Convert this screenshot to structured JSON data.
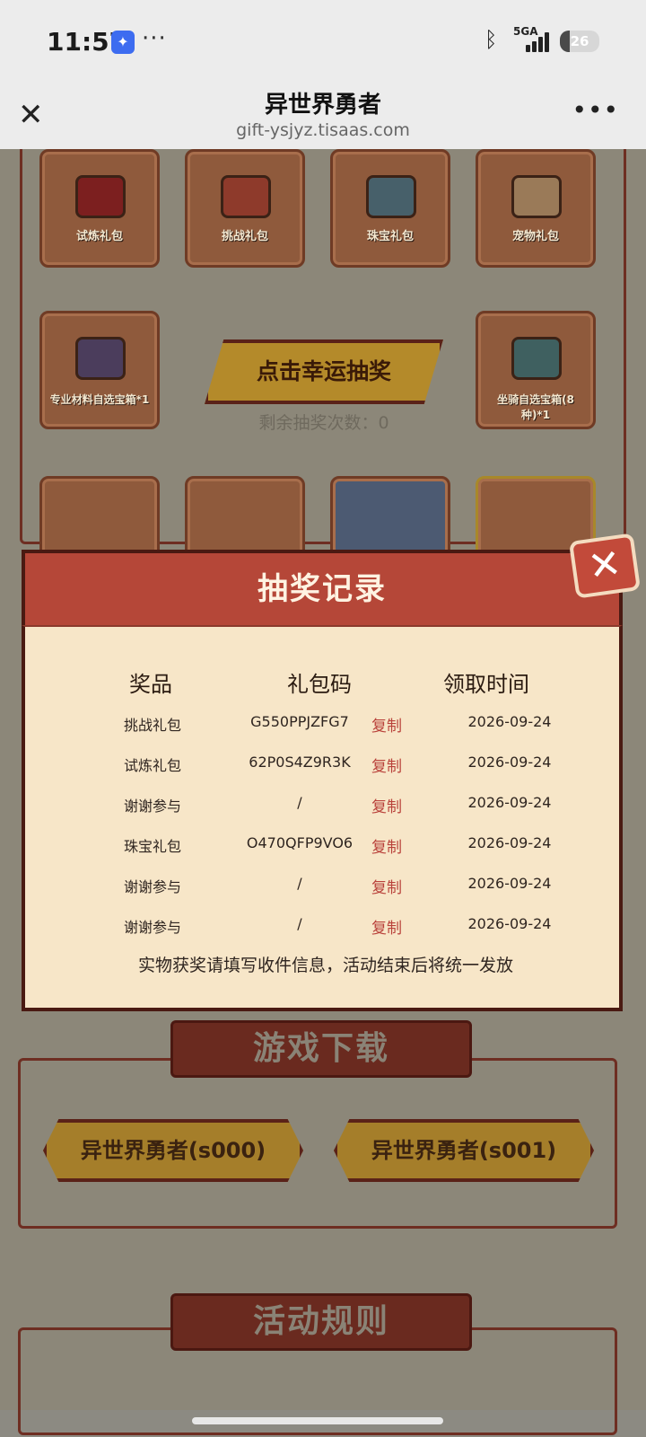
{
  "status_bar": {
    "time": "11:57",
    "network": "5GA",
    "battery": "26",
    "battery_level": 0.26
  },
  "header": {
    "title": "异世界勇者",
    "url": "gift-ysjyz.tisaas.com"
  },
  "background": {
    "tiles_row1": [
      "试炼礼包",
      "挑战礼包",
      "珠宝礼包",
      "宠物礼包"
    ],
    "tile_left": "专业材料自选宝箱*1",
    "tile_right": "坐骑自选宝箱(8种)*1",
    "lottery_button": "点击幸运抽奖",
    "remaining_label": "剩余抽奖次数：",
    "remaining_count": "0",
    "download_section_title": "游戏下载",
    "download_buttons": [
      "异世界勇者(s000)",
      "异世界勇者(s001)"
    ],
    "rules_section_title": "活动规则"
  },
  "modal": {
    "title": "抽奖记录",
    "columns": [
      "奖品",
      "礼包码",
      "领取时间"
    ],
    "copy_label": "复制",
    "records": [
      {
        "prize": "挑战礼包",
        "code": "G550PPJZFG7",
        "date": "2026-09-24"
      },
      {
        "prize": "试炼礼包",
        "code": "62P0S4Z9R3K",
        "date": "2026-09-24"
      },
      {
        "prize": "谢谢参与",
        "code": "/",
        "date": "2026-09-24"
      },
      {
        "prize": "珠宝礼包",
        "code": "O470QFP9VO6",
        "date": "2026-09-24"
      },
      {
        "prize": "谢谢参与",
        "code": "/",
        "date": "2026-09-24"
      },
      {
        "prize": "谢谢参与",
        "code": "/",
        "date": "2026-09-24"
      }
    ],
    "note": "实物获奖请填写收件信息，活动结束后将统一发放"
  }
}
